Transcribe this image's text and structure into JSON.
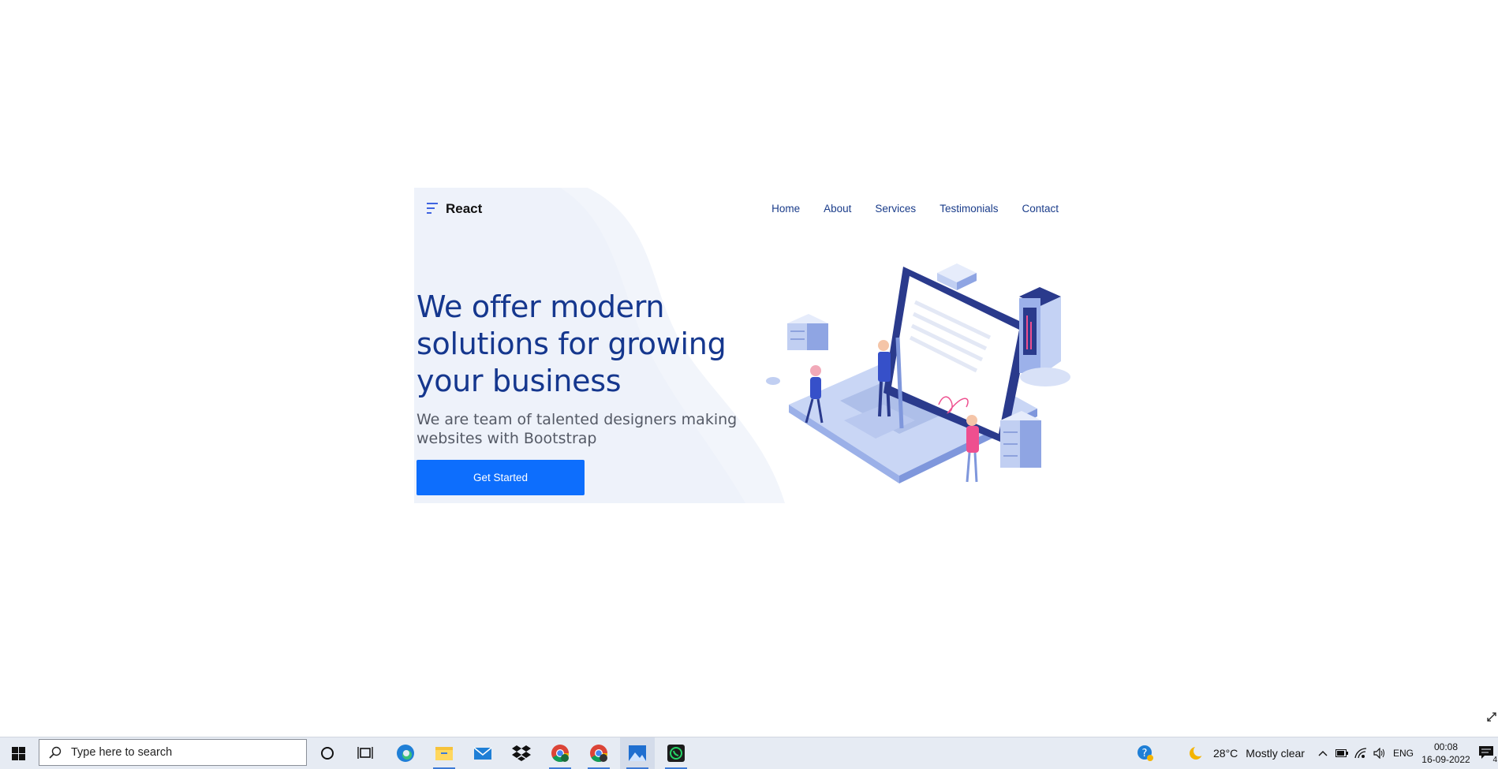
{
  "site": {
    "brand": "React",
    "nav": [
      "Home",
      "About",
      "Services",
      "Testimonials",
      "Contact"
    ],
    "headline": "We offer modern solutions for growing your business",
    "subtitle": "We are team of talented designers making websites with Bootstrap",
    "cta_label": "Get Started",
    "colors": {
      "primary": "#0d6efd",
      "headline": "#15378e",
      "hero_bg": "#f2f5fb"
    }
  },
  "taskbar": {
    "search_placeholder": "Type here to search",
    "apps": [
      "cortana-icon",
      "task-view-icon",
      "edge-icon",
      "file-explorer-icon",
      "mail-icon",
      "dropbox-icon",
      "chrome-icon",
      "chrome-profile-icon",
      "photos-icon",
      "whatsapp-icon"
    ],
    "tray": {
      "weather_temp": "28°C",
      "weather_text": "Mostly clear",
      "language": "ENG",
      "time": "00:08",
      "date": "16-09-2022",
      "notification_count": "4"
    }
  }
}
